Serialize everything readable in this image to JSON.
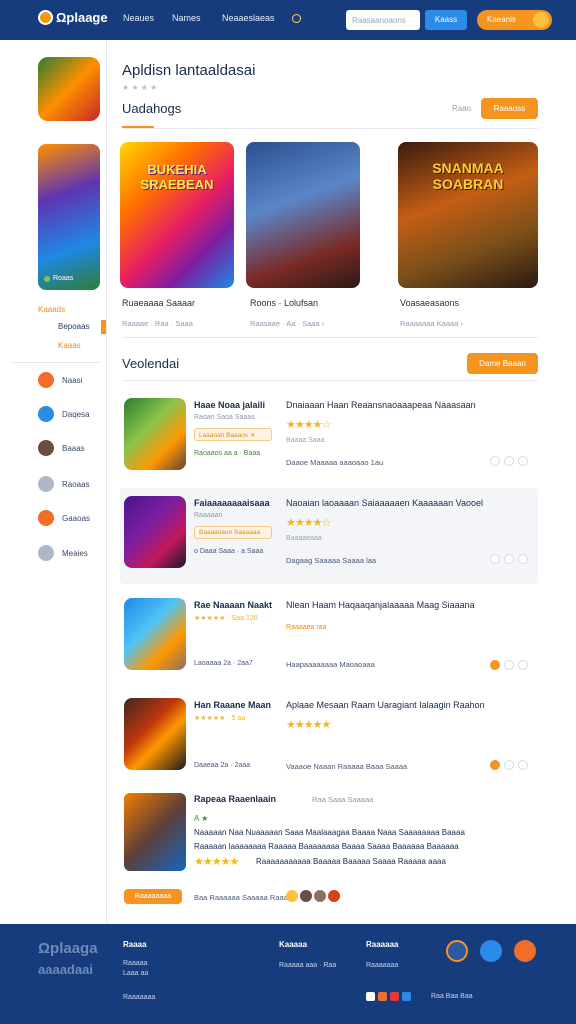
{
  "header": {
    "logo": "Ωplaage",
    "nav": [
      "Neaues",
      "Names",
      "Neaaeslaeas"
    ],
    "search_placeholder": "Raasaanoaons",
    "search_button": "Kaass",
    "cta": "Kaeanis"
  },
  "page": {
    "title": "Apldisn lantaaldasai",
    "rating_hint": "★ ★ ★ ★"
  },
  "sidebar": {
    "promo_label": "Roaas",
    "item_a": "Kaaads",
    "item_b": "Bepoaas",
    "item_c": "Kaaas",
    "items": [
      {
        "label": "Naasi",
        "icon": "game-icon"
      },
      {
        "label": "Daqesa",
        "icon": "compass-icon"
      },
      {
        "label": "Baaas",
        "icon": "avatar-icon"
      },
      {
        "label": "Raoaas",
        "icon": "users-icon"
      },
      {
        "label": "Gaaoas",
        "icon": "controller-icon"
      },
      {
        "label": "Meaies",
        "icon": "person-icon"
      }
    ]
  },
  "section1": {
    "title": "Uadahogs",
    "see_all": "Raao",
    "button": "Raaaoss"
  },
  "cards": [
    {
      "art": "BUKEHIA SRAEBEAN",
      "title": "Ruaeaaaa Saaaar",
      "meta": "Raaaae · Raa · Saaa"
    },
    {
      "art": "",
      "title": "Roons · Lolufsan",
      "meta": "Raasaae · Aa · Saaa ›"
    },
    {
      "art": "SNANMAA SOABRAN",
      "title": "Voasaeasaons",
      "meta": "Raaaaaaa Kaaaa ›"
    }
  ],
  "section2": {
    "title": "Veolendai",
    "button": "Dame Baaan"
  },
  "list": [
    {
      "name": "Haae Noaa jalaili",
      "sub": "Raoan Saoa Saaas",
      "pill": "Laaaoan Baaaos ✕",
      "foot": "Raoaaos aa a · Baaa",
      "desc": "Dnaiaaan Haan Reaansnaoaaapeaa Naaasaan",
      "stars": "★★★★☆",
      "meta": "Baaaa Saaa",
      "bottom": "Daaoe Maaaaa aaaoaao    1au"
    },
    {
      "name": "Faiaaaaaaaaisaaa",
      "sub": "Raaaaan",
      "pill": "Baaaaoaon Saaaaaa",
      "foot": "o Daaa Saaa · a Saaa",
      "desc": "Naoaian laoaaaan Saiaaaaaen Kaaaaaan Vaooel",
      "stars": "★★★★☆",
      "meta": "Baaaaeaaa",
      "bottom": "Dagaag Saaaaa Saaaa laa"
    },
    {
      "name": "Rae Naaaan Naakt",
      "sub": "★★★★★ · Saa  130",
      "pill": "",
      "foot": "Laoaaaa  2a  ·  2aa7",
      "desc": "Nlean Haam Haqaaqanjalaaaaa Maag Siaaana",
      "stars": "",
      "meta": "Raaaaea raa",
      "bottom": "Haapaaaaaaaa Maoaoaaa"
    },
    {
      "name": "Han Raaane Maan",
      "sub": "★★★★★ · 5 aa",
      "pill": "",
      "foot": "Daaeaa  2a  ·  2aaa",
      "desc": "Aplaae Mesaan Raam Uaragiant Ialaagin Raahon",
      "stars": "★★★★★",
      "meta": "",
      "bottom": "Vaaaoe Naaan Raaaaa Baaa Saaaa"
    }
  ],
  "last": {
    "name": "Rapeaa Raaenlaain",
    "sub": "Raa Saaa Saaaaa",
    "stars": "★★★★★",
    "rating": "A  ★",
    "line1": "Naaaaan Naa Nuaaaaan Saaa Maalaaagaa Baaaa Naaa Saaaaaaaa Baaaa",
    "line2": "Raaaaan laaaaaaaa Raaaaa Baaaaaaaa Baaaa Saaaa Baaaaaa Baaaaaa",
    "line3": "Raaaaaaaaaaa Baaaaa Baaaaa Saaaa Raaaaa aaaa",
    "button": "Raaaaaaaa",
    "footer_text": "Baa Raaaaaa Saaaaa Raaaa"
  },
  "footer": {
    "logo": "Ωplaaga",
    "logo2": "aaaadaai",
    "col1_title": "Raaaa",
    "col1_links": [
      "Raaaaa",
      "Laaa aa"
    ],
    "col2_title": "Kaaaaa",
    "col2_link": "Raaaaa aaa  ·  Raa",
    "col3_title": "Raaaaaa",
    "col3_link": "Raaaaaaa",
    "copyright": "Raaaaaaa",
    "bottom_right": "Raa  Baa  Baa"
  },
  "colors": {
    "header": "#173c7e",
    "accent": "#f5941e",
    "blue": "#2a8be8"
  }
}
